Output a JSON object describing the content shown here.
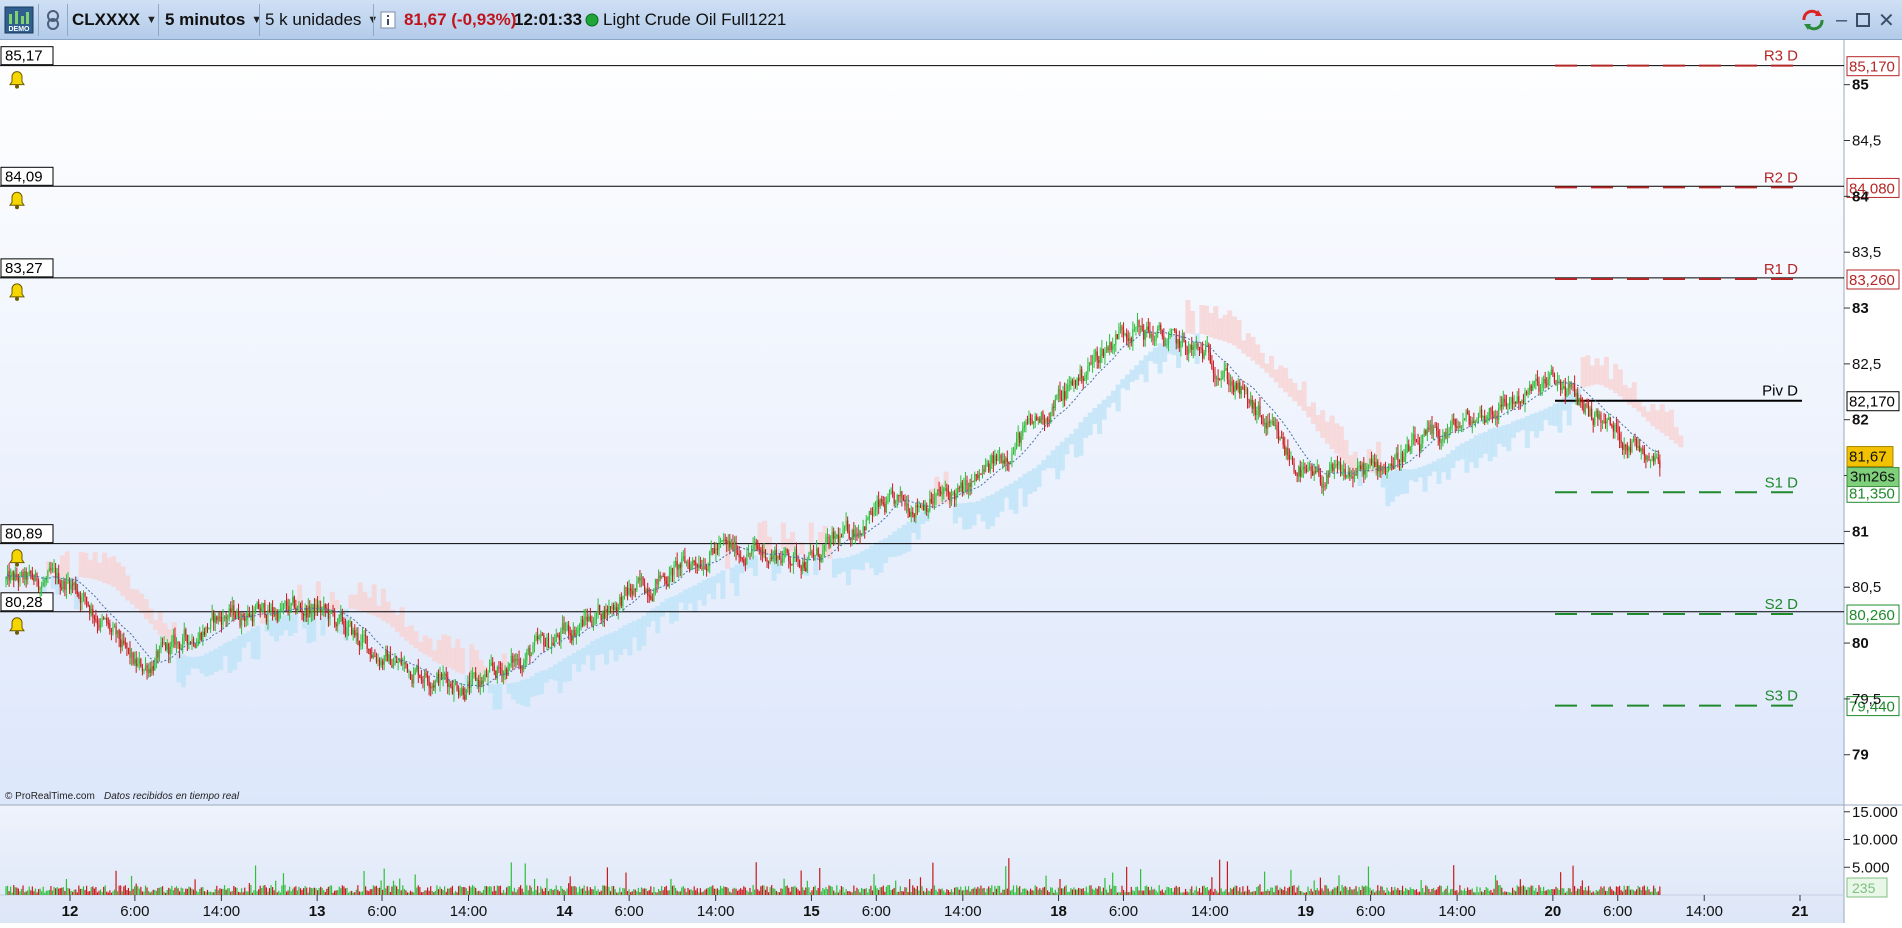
{
  "toolbar": {
    "demo_badge": "DEMO",
    "instrument": "CLXXXX",
    "timeframe": "5 minutos",
    "units": "5 k unidades",
    "price_change": "81,67 (-0,93%)",
    "clock": "12:01:33",
    "instrument_name": "Light Crude Oil Full1221"
  },
  "watermark": {
    "brand": "© ProRealTime.com",
    "note": "Datos recibidos en tiempo real"
  },
  "colors": {
    "up": "#2fbf3a",
    "down": "#c81a1a",
    "resistance": "#b52626",
    "support": "#1f8a2c",
    "pivot": "#000000",
    "price_tag": "#f2c200",
    "cloud_up": "#bfe3f7",
    "cloud_down": "#f7d3d3"
  },
  "chart_data": [
    {
      "type": "line",
      "subtype": "candlestick",
      "ylim": [
        78.55,
        85.4
      ],
      "y_ticks": [
        "85",
        "84,5",
        "84",
        "83,5",
        "83",
        "82,5",
        "82",
        "81,5",
        "81",
        "80,5",
        "80",
        "79,5",
        "79"
      ],
      "y_tick_values": [
        85,
        84.5,
        84,
        83.5,
        83,
        82.5,
        82,
        81.5,
        81,
        80.5,
        80,
        79.5,
        79
      ],
      "x_ticks": [
        "12",
        "6:00",
        "14:00",
        "13",
        "6:00",
        "14:00",
        "14",
        "6:00",
        "14:00",
        "15",
        "6:00",
        "14:00",
        "18",
        "6:00",
        "14:00",
        "19",
        "6:00",
        "14:00",
        "20",
        "6:00",
        "14:00",
        "21"
      ],
      "x_day_ticks": [
        "12",
        "13",
        "14",
        "15",
        "18",
        "19",
        "20",
        "21"
      ],
      "series": [
        {
          "x": [
            "12 00:00",
            "12 06:00",
            "12 14:00",
            "13 00:00",
            "13 06:00",
            "13 14:00",
            "14 00:00",
            "14 06:00",
            "14 14:00",
            "15 00:00",
            "15 06:00",
            "15 14:00",
            "18 00:00",
            "18 06:00",
            "18 14:00",
            "19 00:00",
            "19 06:00",
            "19 14:00",
            "20 00:00",
            "20 06:00",
            "20 10:00"
          ],
          "values": [
            80.55,
            79.75,
            80.25,
            80.3,
            79.85,
            79.6,
            80.1,
            80.45,
            80.85,
            80.75,
            81.2,
            81.35,
            82.2,
            82.85,
            82.55,
            81.45,
            81.55,
            81.95,
            82.35,
            81.85,
            81.65
          ]
        }
      ],
      "price_alerts": [
        "85,17",
        "84,09",
        "83,27",
        "80,89",
        "80,28"
      ],
      "price_alert_values": [
        85.17,
        84.09,
        83.27,
        80.89,
        80.28
      ],
      "pivot_levels": [
        {
          "label": "R3 D",
          "value": 85.17,
          "axis_label": "85,170",
          "kind": "resistance"
        },
        {
          "label": "R2 D",
          "value": 84.08,
          "axis_label": "84,080",
          "kind": "resistance"
        },
        {
          "label": "R1 D",
          "value": 83.26,
          "axis_label": "83,260",
          "kind": "resistance"
        },
        {
          "label": "Piv D",
          "value": 82.17,
          "axis_label": "82,170",
          "kind": "pivot"
        },
        {
          "label": "S1 D",
          "value": 81.35,
          "axis_label": "81,350",
          "kind": "support"
        },
        {
          "label": "S2 D",
          "value": 80.26,
          "axis_label": "80,260",
          "kind": "support"
        },
        {
          "label": "S3 D",
          "value": 79.44,
          "axis_label": "79,440",
          "kind": "support"
        }
      ],
      "last_price": {
        "value": 81.67,
        "label": "81,67",
        "countdown": "3m26s"
      }
    },
    {
      "type": "bar",
      "subtype": "volume",
      "ylim": [
        0,
        15500
      ],
      "y_ticks": [
        "15.000",
        "10.000",
        "5.000"
      ],
      "y_tick_values": [
        15000,
        10000,
        5000
      ],
      "last_volume": "235",
      "last_volume_value": 235
    }
  ]
}
